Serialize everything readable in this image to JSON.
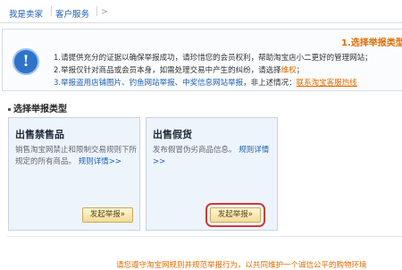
{
  "breadcrumb": {
    "items": [
      "我是卖家",
      "客户服务",
      ">"
    ]
  },
  "notice": {
    "step_title": "1.选择举报类型",
    "line1": "1.请提供充分的证据以确保举报成功，请珍惜您的会员权利，帮助淘宝店小二更好的管理网站；",
    "line2_prefix": "2.举报仅针对商品或会员本身，如需处理交易中产生的纠纷，请选择",
    "line2_link": "维权",
    "line2_suffix": "；",
    "line3_prefix": "3.",
    "line3_links": "举报盗用店铺图片、钓鱼网站举报、中奖信息网站举报",
    "line3_mid": "，非上述情况：",
    "line3_hotline": "联系淘宝客服热线"
  },
  "section": {
    "title": "选择举报类型"
  },
  "panels": [
    {
      "title": "出售禁售品",
      "desc": "销售淘宝网禁止和限制交易规则下所规定的所有商品。",
      "link": "规则详情>>",
      "button": "发起举报»"
    },
    {
      "title": "出售假货",
      "desc": "发布假冒伪劣商品信息。",
      "link": "规则详情>>",
      "button": "发起举报»"
    }
  ],
  "footer": {
    "text": "请您遵守淘宝网规则并规范举报行为，以共同维护一个诚信公平的购物环境"
  },
  "colors": {
    "link_blue": "#1a5fb4",
    "accent_orange": "#e06b00",
    "highlight_red": "#d23a3a",
    "panel_bg": "#eef4fb"
  },
  "icons": {
    "notice": "info-icon"
  }
}
